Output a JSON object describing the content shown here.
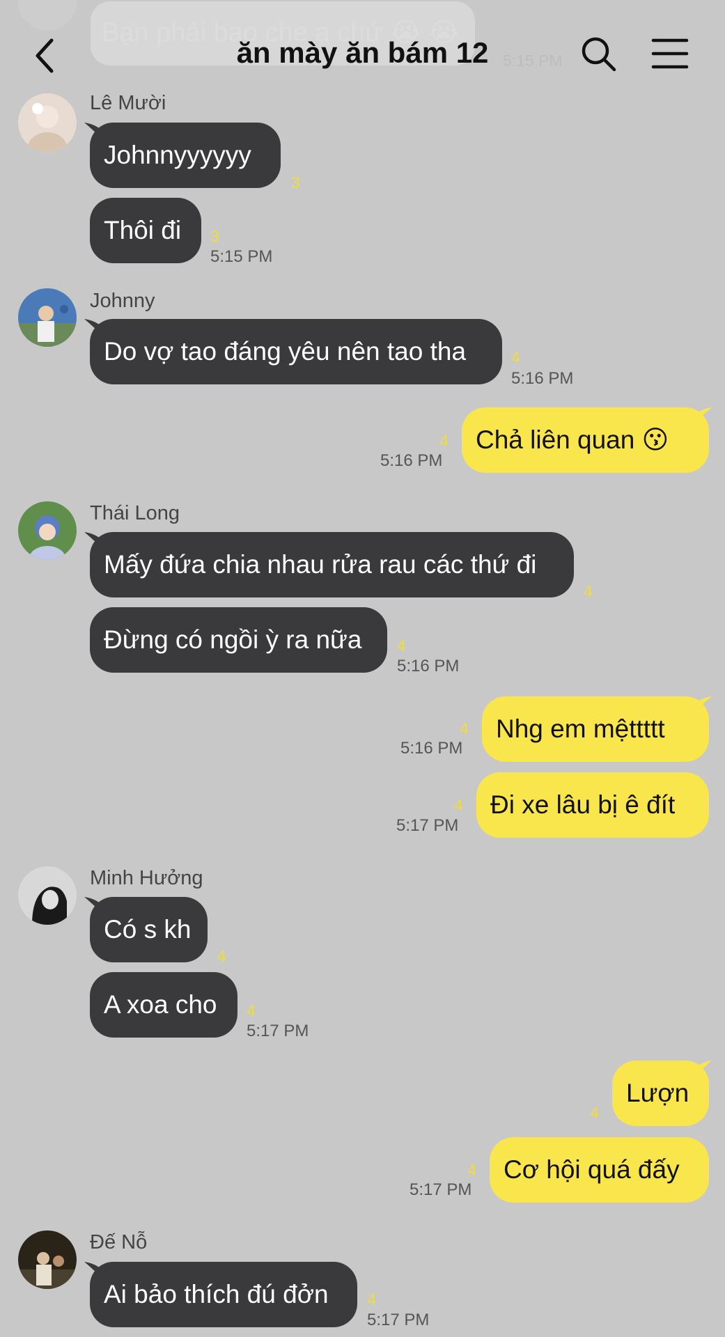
{
  "header": {
    "title": "ăn mày ăn bám 12",
    "prev_message": "Bạn phải bao che a chứ 😭 😭",
    "prev_time": "5:15 PM"
  },
  "messages": [
    {
      "sender": "Lê Mười",
      "texts": [
        "Johnnyyyyyy",
        "Thôi đi"
      ],
      "unread": [
        "3",
        "3"
      ],
      "time": "5:15 PM"
    },
    {
      "sender": "Johnny",
      "texts": [
        "Do vợ tao đáng yêu nên tao tha"
      ],
      "unread": [
        "4"
      ],
      "time": "5:16 PM"
    },
    {
      "sender": "",
      "texts": [
        "Chả liên quan 😗"
      ],
      "unread": [
        "4"
      ],
      "time": "5:16 PM"
    },
    {
      "sender": "Thái Long",
      "texts": [
        "Mấy đứa chia nhau rửa rau các thứ đi",
        "Đừng có ngồi ỳ ra nữa"
      ],
      "unread": [
        "4",
        "4"
      ],
      "time": "5:16 PM"
    },
    {
      "sender": "",
      "texts": [
        "Nhg em mệttttt"
      ],
      "unread": [
        "4"
      ],
      "time": "5:16 PM"
    },
    {
      "sender": "",
      "texts": [
        "Đi xe lâu bị ê đít"
      ],
      "unread": [
        "4"
      ],
      "time": "5:17 PM"
    },
    {
      "sender": "Minh Hưởng",
      "texts": [
        "Có s kh",
        "A xoa cho"
      ],
      "unread": [
        "4",
        "4"
      ],
      "time": "5:17 PM"
    },
    {
      "sender": "",
      "texts": [
        "Lượn",
        "Cơ hội quá đấy"
      ],
      "unread": [
        "4",
        "4"
      ],
      "time": "5:17 PM"
    },
    {
      "sender": "Đế Nỗ",
      "texts": [
        "Ai bảo thích đú đởn"
      ],
      "unread": [
        "4"
      ],
      "time": "5:17 PM"
    }
  ],
  "colors": {
    "background": "#c8c8c8",
    "incoming_bubble": "#3a3a3c",
    "outgoing_bubble": "#f9e54c",
    "unread_count": "#f0dc3c"
  },
  "icons": [
    "back-arrow-icon",
    "search-icon",
    "menu-icon"
  ]
}
